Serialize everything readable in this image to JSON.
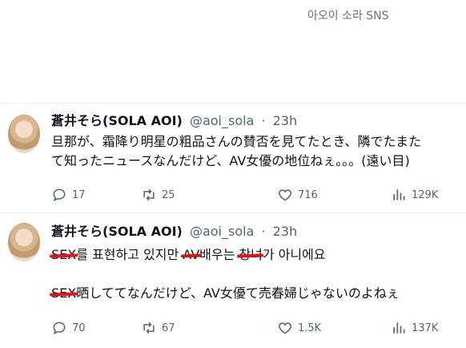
{
  "caption": "아오이 소라 SNS",
  "tweets": [
    {
      "name": "蒼井そら(SOLA AOI)",
      "handle": "@aoi_sola",
      "time": "23h",
      "line1": "旦那が、霜降り明星の粗品さんの賛否を見てたとき、隣でたまた",
      "line2": "て知ったニュースなんだけど、AV女優の地位ねぇ。。。(遠い目)",
      "replies": "17",
      "retweets": "25",
      "likes": "716",
      "views": "129K"
    },
    {
      "name": "蒼井そら(SOLA AOI)",
      "handle": "@aoi_sola",
      "time": "23h",
      "line1": {
        "r1": "SEX",
        "p1": "를 표현하고 있지만 ",
        "r2": "AV",
        "p2": "배우는 ",
        "r3": "창녀",
        "p3": "가 아니에요"
      },
      "line2": {
        "r1": "SEX",
        "p1": "晒しててなんだけど、AV女優て売春婦じゃないのよねぇ"
      },
      "replies": "70",
      "retweets": "67",
      "likes": "1.5K",
      "views": "137K"
    }
  ],
  "icons": {
    "reply": "reply-icon",
    "retweet": "retweet-icon",
    "like": "like-icon",
    "views": "views-icon"
  },
  "colors": {
    "redaction": "#e0101a",
    "muted": "#536471"
  }
}
